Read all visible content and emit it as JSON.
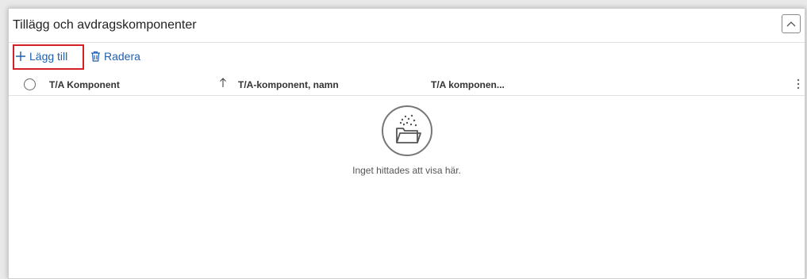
{
  "panel": {
    "title": "Tillägg och avdragskomponenter",
    "collapse_icon": "chevron-up-icon"
  },
  "toolbar": {
    "add_label": "Lägg till",
    "add_icon": "plus-icon",
    "delete_label": "Radera",
    "delete_icon": "trash-icon"
  },
  "grid": {
    "columns": [
      "T/A Komponent",
      "T/A-komponent, namn",
      "T/A komponen..."
    ],
    "sort_icon": "arrow-up-icon",
    "more_icon": "more-vertical-icon",
    "empty_message": "Inget hittades att visa här.",
    "empty_icon": "empty-folder-icon"
  },
  "colors": {
    "accent": "#1f5fae",
    "highlight": "#d32027"
  }
}
